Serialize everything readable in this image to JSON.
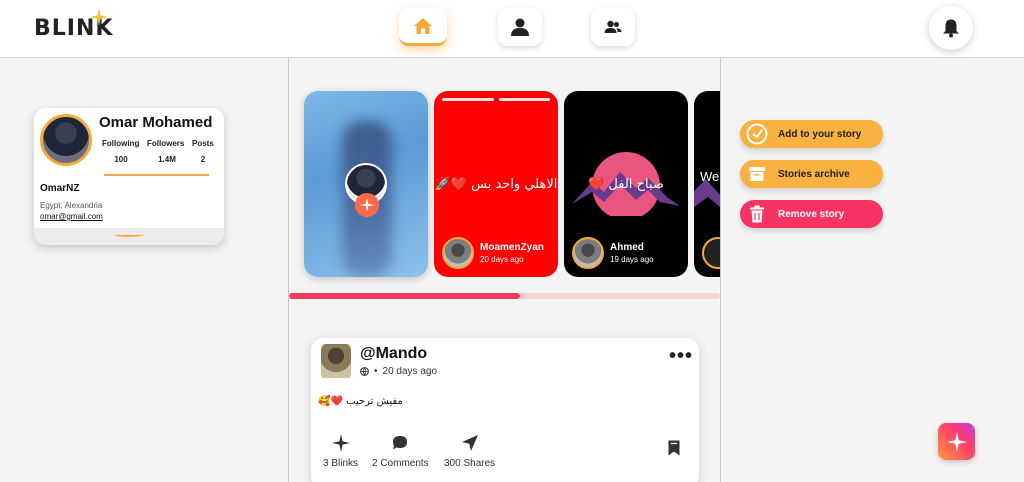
{
  "header": {
    "logo": "BLINK",
    "nav": [
      {
        "label": "home",
        "icon": "home-icon",
        "active": true
      },
      {
        "label": "profile",
        "icon": "user-icon",
        "active": false
      },
      {
        "label": "friends",
        "icon": "users-icon",
        "active": false
      }
    ],
    "notifications_icon": "bell-icon"
  },
  "profile": {
    "name": "Omar Mohamed",
    "stats": [
      {
        "label": "Following",
        "value": "100"
      },
      {
        "label": "Followers",
        "value": "1.4M"
      },
      {
        "label": "Posts",
        "value": "2"
      }
    ],
    "handle": "OmarNZ",
    "location": "Egypt, Alexandria",
    "email": "omar@gmail.com"
  },
  "stories": [
    {
      "type": "add-story"
    },
    {
      "user": "MoamenZyan",
      "time": "20 days ago",
      "text": "الاهلي واحد بس ❤️🚀"
    },
    {
      "user": "Ahmed",
      "time": "19 days ago",
      "text": "صباح الفل ❤️"
    },
    {
      "text": "We"
    }
  ],
  "stories_scroll_progress": 0.536,
  "post": {
    "user": "@Mando",
    "time": "20 days ago",
    "text": "مفيش ترحيب ❤️🥰",
    "actions": [
      {
        "label": "3 Blinks",
        "icon": "sparkle-icon"
      },
      {
        "label": "2 Comments",
        "icon": "comment-icon"
      },
      {
        "label": "300 Shares",
        "icon": "send-icon"
      }
    ]
  },
  "story_actions": [
    {
      "label": "Add to your story",
      "icon": "add-story-icon",
      "color": "#f9b13f"
    },
    {
      "label": "Stories archive",
      "icon": "archive-icon",
      "color": "#f9b13f"
    },
    {
      "label": "Remove story",
      "icon": "trash-icon",
      "color": "#f73363"
    }
  ],
  "colors": {
    "accent": "#f7a93b",
    "danger": "#f73363",
    "story_red": "#ff0000"
  }
}
